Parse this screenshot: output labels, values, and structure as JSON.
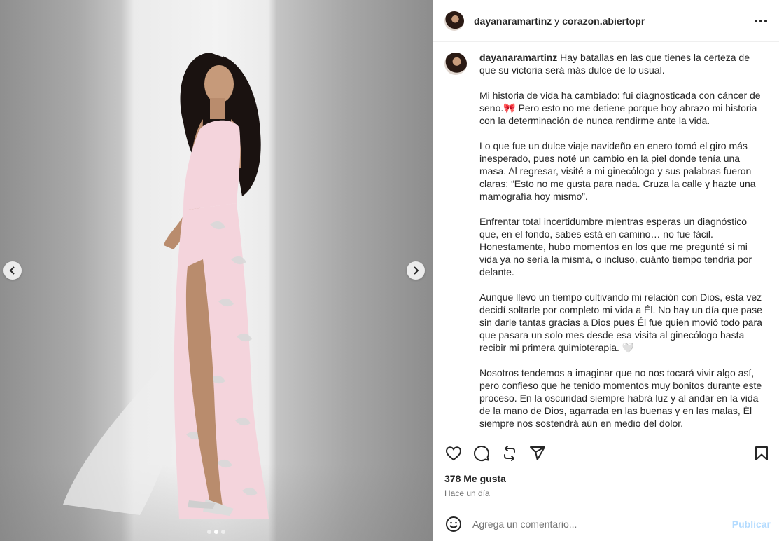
{
  "post": {
    "header_user": "dayanaramartinz",
    "header_joiner": "y",
    "header_collaborator": "corazon.abiertopr",
    "more_icon": "more-horizontal-icon"
  },
  "media": {
    "prev_icon": "chevron-left-icon",
    "next_icon": "chevron-right-icon",
    "slides_total": 3,
    "slide_active": 2
  },
  "caption": {
    "user": "dayanaramartinz",
    "paragraphs": [
      "Hay batallas en las que tienes la certeza de que su victoria será más dulce de lo usual.",
      "Mi historia de vida ha cambiado: fui diagnosticada con cáncer de seno.🎀 Pero esto no me detiene porque hoy abrazo mi historia con la determinación de nunca rendirme ante la vida.",
      "Lo que fue un dulce viaje navideño en enero tomó el giro más inesperado, pues noté un cambio en la piel donde tenía una masa. Al regresar, visité a mi ginecólogo y sus palabras fueron claras: “Esto no me gusta para nada. Cruza la calle y hazte una mamografía hoy mismo”.",
      "Enfrentar total incertidumbre mientras esperas un diagnóstico que, en el fondo, sabes está en camino… no fue fácil. Honestamente, hubo momentos en los que me pregunté si mi vida ya no sería la misma, o incluso, cuánto tiempo tendría por delante.",
      "Aunque llevo un tiempo cultivando mi relación con Dios, esta vez decidí soltarle por completo mi vida a Él. No hay un día que pase sin darle tantas gracias a Dios pues Él fue quien movió todo para que pasara un solo mes desde esa visita al ginecólogo hasta recibir mi primera quimioterapia. 🤍",
      "Nosotros tendemos a imaginar que no nos tocará vivir algo así, pero confieso que he tenido momentos muy bonitos durante este proceso. En la oscuridad siempre habrá luz y al andar en la vida de la mano de Dios, agarrada en las buenas y en las malas, Él siempre nos sostendrá aún en medio del dolor."
    ]
  },
  "actions": {
    "like_icon": "heart-icon",
    "comment_icon": "comment-icon",
    "repost_icon": "repost-icon",
    "share_icon": "share-icon",
    "save_icon": "bookmark-icon"
  },
  "stats": {
    "likes": "378 Me gusta",
    "time": "Hace un día"
  },
  "comment": {
    "emoji_icon": "emoji-icon",
    "placeholder": "Agrega un comentario...",
    "publish_label": "Publicar"
  },
  "colors": {
    "publish_disabled": "#b3dbff",
    "divider": "#efefef",
    "text_primary": "#262626",
    "text_secondary": "#737373",
    "dress": "#f4d4dc"
  }
}
